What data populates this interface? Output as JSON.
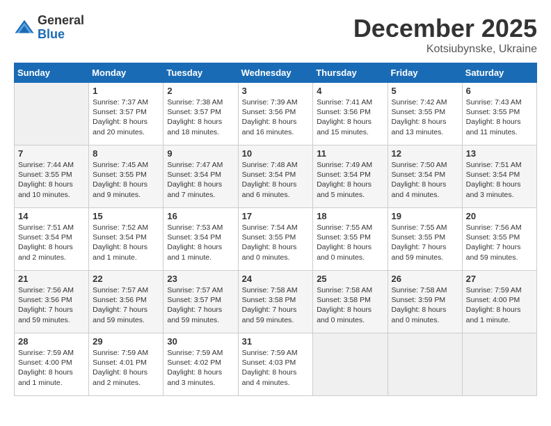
{
  "logo": {
    "general": "General",
    "blue": "Blue"
  },
  "header": {
    "month": "December 2025",
    "location": "Kotsiubynske, Ukraine"
  },
  "weekdays": [
    "Sunday",
    "Monday",
    "Tuesday",
    "Wednesday",
    "Thursday",
    "Friday",
    "Saturday"
  ],
  "weeks": [
    [
      {
        "day": "",
        "sunrise": "",
        "sunset": "",
        "daylight": ""
      },
      {
        "day": "1",
        "sunrise": "Sunrise: 7:37 AM",
        "sunset": "Sunset: 3:57 PM",
        "daylight": "Daylight: 8 hours and 20 minutes."
      },
      {
        "day": "2",
        "sunrise": "Sunrise: 7:38 AM",
        "sunset": "Sunset: 3:57 PM",
        "daylight": "Daylight: 8 hours and 18 minutes."
      },
      {
        "day": "3",
        "sunrise": "Sunrise: 7:39 AM",
        "sunset": "Sunset: 3:56 PM",
        "daylight": "Daylight: 8 hours and 16 minutes."
      },
      {
        "day": "4",
        "sunrise": "Sunrise: 7:41 AM",
        "sunset": "Sunset: 3:56 PM",
        "daylight": "Daylight: 8 hours and 15 minutes."
      },
      {
        "day": "5",
        "sunrise": "Sunrise: 7:42 AM",
        "sunset": "Sunset: 3:55 PM",
        "daylight": "Daylight: 8 hours and 13 minutes."
      },
      {
        "day": "6",
        "sunrise": "Sunrise: 7:43 AM",
        "sunset": "Sunset: 3:55 PM",
        "daylight": "Daylight: 8 hours and 11 minutes."
      }
    ],
    [
      {
        "day": "7",
        "sunrise": "Sunrise: 7:44 AM",
        "sunset": "Sunset: 3:55 PM",
        "daylight": "Daylight: 8 hours and 10 minutes."
      },
      {
        "day": "8",
        "sunrise": "Sunrise: 7:45 AM",
        "sunset": "Sunset: 3:55 PM",
        "daylight": "Daylight: 8 hours and 9 minutes."
      },
      {
        "day": "9",
        "sunrise": "Sunrise: 7:47 AM",
        "sunset": "Sunset: 3:54 PM",
        "daylight": "Daylight: 8 hours and 7 minutes."
      },
      {
        "day": "10",
        "sunrise": "Sunrise: 7:48 AM",
        "sunset": "Sunset: 3:54 PM",
        "daylight": "Daylight: 8 hours and 6 minutes."
      },
      {
        "day": "11",
        "sunrise": "Sunrise: 7:49 AM",
        "sunset": "Sunset: 3:54 PM",
        "daylight": "Daylight: 8 hours and 5 minutes."
      },
      {
        "day": "12",
        "sunrise": "Sunrise: 7:50 AM",
        "sunset": "Sunset: 3:54 PM",
        "daylight": "Daylight: 8 hours and 4 minutes."
      },
      {
        "day": "13",
        "sunrise": "Sunrise: 7:51 AM",
        "sunset": "Sunset: 3:54 PM",
        "daylight": "Daylight: 8 hours and 3 minutes."
      }
    ],
    [
      {
        "day": "14",
        "sunrise": "Sunrise: 7:51 AM",
        "sunset": "Sunset: 3:54 PM",
        "daylight": "Daylight: 8 hours and 2 minutes."
      },
      {
        "day": "15",
        "sunrise": "Sunrise: 7:52 AM",
        "sunset": "Sunset: 3:54 PM",
        "daylight": "Daylight: 8 hours and 1 minute."
      },
      {
        "day": "16",
        "sunrise": "Sunrise: 7:53 AM",
        "sunset": "Sunset: 3:54 PM",
        "daylight": "Daylight: 8 hours and 1 minute."
      },
      {
        "day": "17",
        "sunrise": "Sunrise: 7:54 AM",
        "sunset": "Sunset: 3:55 PM",
        "daylight": "Daylight: 8 hours and 0 minutes."
      },
      {
        "day": "18",
        "sunrise": "Sunrise: 7:55 AM",
        "sunset": "Sunset: 3:55 PM",
        "daylight": "Daylight: 8 hours and 0 minutes."
      },
      {
        "day": "19",
        "sunrise": "Sunrise: 7:55 AM",
        "sunset": "Sunset: 3:55 PM",
        "daylight": "Daylight: 7 hours and 59 minutes."
      },
      {
        "day": "20",
        "sunrise": "Sunrise: 7:56 AM",
        "sunset": "Sunset: 3:55 PM",
        "daylight": "Daylight: 7 hours and 59 minutes."
      }
    ],
    [
      {
        "day": "21",
        "sunrise": "Sunrise: 7:56 AM",
        "sunset": "Sunset: 3:56 PM",
        "daylight": "Daylight: 7 hours and 59 minutes."
      },
      {
        "day": "22",
        "sunrise": "Sunrise: 7:57 AM",
        "sunset": "Sunset: 3:56 PM",
        "daylight": "Daylight: 7 hours and 59 minutes."
      },
      {
        "day": "23",
        "sunrise": "Sunrise: 7:57 AM",
        "sunset": "Sunset: 3:57 PM",
        "daylight": "Daylight: 7 hours and 59 minutes."
      },
      {
        "day": "24",
        "sunrise": "Sunrise: 7:58 AM",
        "sunset": "Sunset: 3:58 PM",
        "daylight": "Daylight: 7 hours and 59 minutes."
      },
      {
        "day": "25",
        "sunrise": "Sunrise: 7:58 AM",
        "sunset": "Sunset: 3:58 PM",
        "daylight": "Daylight: 8 hours and 0 minutes."
      },
      {
        "day": "26",
        "sunrise": "Sunrise: 7:58 AM",
        "sunset": "Sunset: 3:59 PM",
        "daylight": "Daylight: 8 hours and 0 minutes."
      },
      {
        "day": "27",
        "sunrise": "Sunrise: 7:59 AM",
        "sunset": "Sunset: 4:00 PM",
        "daylight": "Daylight: 8 hours and 1 minute."
      }
    ],
    [
      {
        "day": "28",
        "sunrise": "Sunrise: 7:59 AM",
        "sunset": "Sunset: 4:00 PM",
        "daylight": "Daylight: 8 hours and 1 minute."
      },
      {
        "day": "29",
        "sunrise": "Sunrise: 7:59 AM",
        "sunset": "Sunset: 4:01 PM",
        "daylight": "Daylight: 8 hours and 2 minutes."
      },
      {
        "day": "30",
        "sunrise": "Sunrise: 7:59 AM",
        "sunset": "Sunset: 4:02 PM",
        "daylight": "Daylight: 8 hours and 3 minutes."
      },
      {
        "day": "31",
        "sunrise": "Sunrise: 7:59 AM",
        "sunset": "Sunset: 4:03 PM",
        "daylight": "Daylight: 8 hours and 4 minutes."
      },
      {
        "day": "",
        "sunrise": "",
        "sunset": "",
        "daylight": ""
      },
      {
        "day": "",
        "sunrise": "",
        "sunset": "",
        "daylight": ""
      },
      {
        "day": "",
        "sunrise": "",
        "sunset": "",
        "daylight": ""
      }
    ]
  ]
}
